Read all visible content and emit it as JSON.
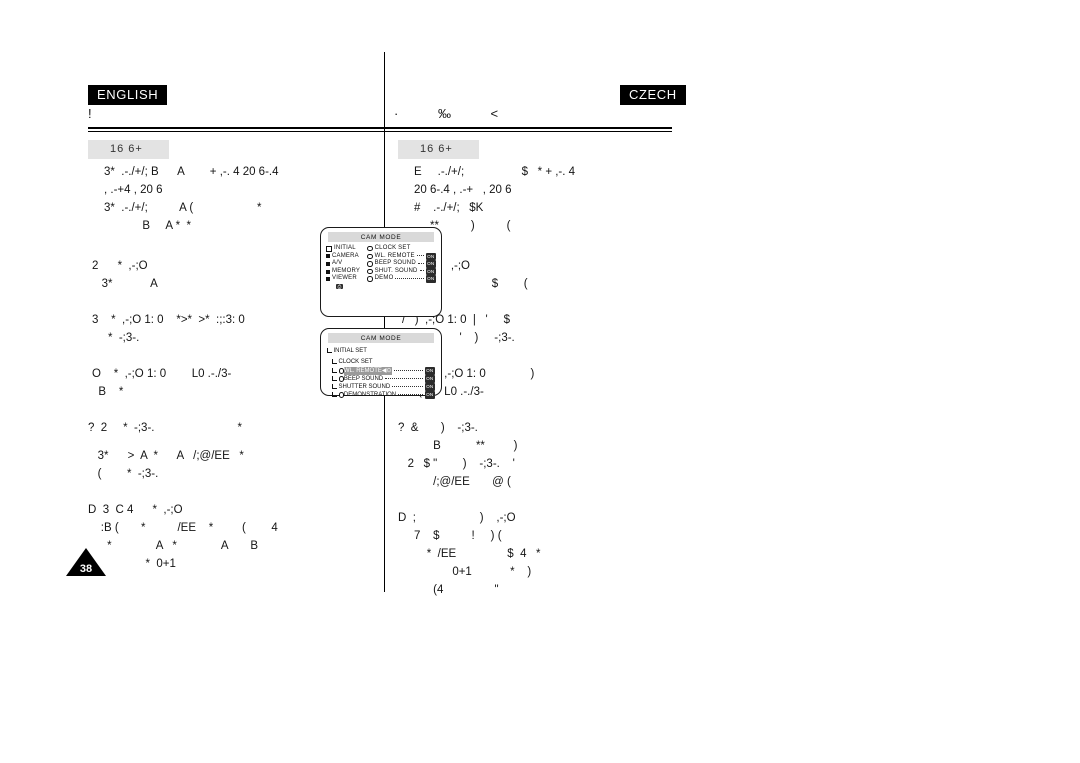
{
  "page": {
    "number": "38",
    "title_left": "!",
    "title_right": "·      ‰      <"
  },
  "languages": {
    "left_badge": "ENGLISH",
    "right_badge": "CZECH"
  },
  "columns": {
    "english": {
      "section_header": "16  6+",
      "blocks": [
        "3*  .-./+/; B      A        + ,-. 4 20 6-.4",
        ", .-+4 , 20 6",
        "3*  .-./+/;          A (                    *",
        "            B     A *  *",
        "2      *  ,-;O",
        "   3*            A",
        "3    *  ,-;O 1: 0    *>*  >*  :;:3: 0",
        "     *  -;3-.",
        "O    *  ,-;O 1: 0        L0 .-./3-",
        "  B    *",
        "?  2     *  -;3-.                          *",
        "   3*      >  A  *      A   /;@/EE   *",
        "   (        *  -;3-.",
        "D  3  C 4      *  ,-;O",
        "    :B (       *          /EE    *         (        4",
        "      *              A   *              A       B",
        "                  *  0+1"
      ]
    },
    "czech": {
      "section_header": "16  6+",
      "blocks": [
        "E     .-./+/;                  $   * + ,-. 4",
        "20 6-.4 , .-+   , 20 6",
        "#    .-./+/;   $K",
        "     **          )          (",
        "&   '    )    ,-;O",
        "      =                    $        (",
        "/   )  ,-;O 1: 0  |   '     $",
        " :;:3: 0        '    )     -;3-.",
        "2        )  ,-;O 1: 0              )",
        "     (   $  L0 .-./3-",
        "?  &       )    -;3-.",
        "           B           **         )",
        "   2   $ \"        )    -;3-.    '",
        "           /;@/EE       @ (",
        "D  ;                    )    ,-;O",
        "     7    $          !     ) (",
        "         *  /EE                $  4   *",
        "                 0+1            *    )",
        "           (4                \""
      ]
    }
  },
  "osd_menus": [
    {
      "id": "cam-mode-main",
      "title": "CAM MODE",
      "left_pane": [
        {
          "label": "INITIAL",
          "icon": "square-open-icon",
          "selected": true
        },
        {
          "label": "CAMERA",
          "icon": "square-filled-icon",
          "selected": false
        },
        {
          "label": "A/V",
          "icon": "square-filled-icon",
          "selected": false
        },
        {
          "label": "MEMORY",
          "icon": "square-filled-icon",
          "selected": false
        },
        {
          "label": "VIEWER",
          "icon": "square-filled-icon",
          "selected": false
        }
      ],
      "left_extra_badge": "⎙",
      "right_pane": [
        {
          "label": "CLOCK SET",
          "icon": "circle-icon",
          "dots": false,
          "badge": ""
        },
        {
          "label": "WL. REMOTE",
          "icon": "circle-icon",
          "dots": true,
          "badge": "ON"
        },
        {
          "label": "BEEP SOUND",
          "icon": "circle-icon",
          "dots": true,
          "badge": "ON"
        },
        {
          "label": "SHUT. SOUND",
          "icon": "circle-icon",
          "dots": true,
          "badge": "ON"
        },
        {
          "label": "DEMO",
          "icon": "circle-icon",
          "dots": true,
          "badge": "ON"
        }
      ]
    },
    {
      "id": "initial-set-submenu",
      "title": "CAM MODE",
      "header": "INITIAL SET",
      "sub_header": "CLOCK SET",
      "rows": [
        {
          "label": "WL. REMOTE",
          "icon": "circle-icon",
          "selected": true,
          "marker": "◀⊙",
          "badge": "ON"
        },
        {
          "label": "BEEP SOUND",
          "icon": "circle-icon",
          "selected": false,
          "marker": "",
          "badge": "ON"
        },
        {
          "label": "SHUTTER SOUND",
          "icon": "square-filled-icon",
          "selected": false,
          "marker": "",
          "badge": "ON"
        },
        {
          "label": "DEMONSTRATION",
          "icon": "circle-icon",
          "selected": false,
          "marker": "",
          "badge": "ON"
        }
      ]
    }
  ],
  "colors": {
    "badge_bg": "#000000",
    "badge_fg": "#ffffff",
    "section_header_bg": "#e3e3e3",
    "osd_title_bg": "#d9d9d9",
    "osd_badge_bg": "#2b2b2b",
    "osd_selected_bg": "#9a9a9a",
    "text": "#111111"
  }
}
